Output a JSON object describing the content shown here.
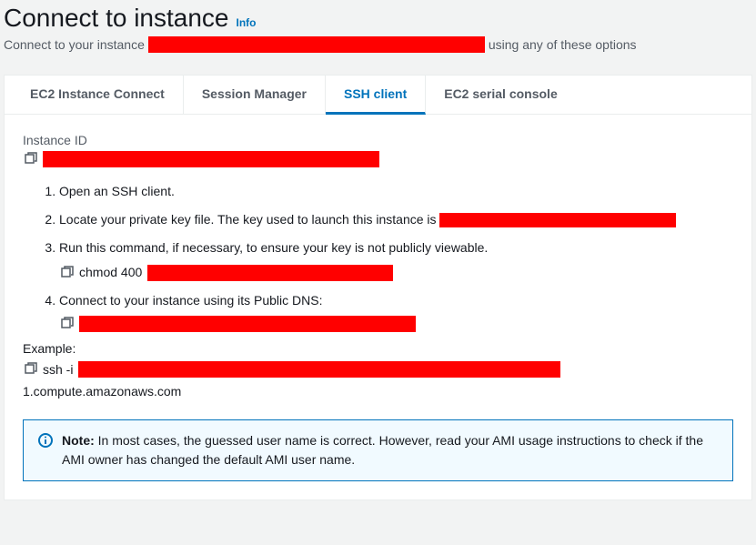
{
  "header": {
    "title": "Connect to instance",
    "info": "Info",
    "subtitle_prefix": "Connect to your instance",
    "subtitle_suffix": "using any of these options"
  },
  "tabs": {
    "ec2_connect": "EC2 Instance Connect",
    "session_manager": "Session Manager",
    "ssh_client": "SSH client",
    "serial_console": "EC2 serial console"
  },
  "content": {
    "instance_id_label": "Instance ID",
    "step1": "Open an SSH client.",
    "step2_prefix": "Locate your private key file. The key used to launch this instance is ",
    "step3": "Run this command, if necessary, to ensure your key is not publicly viewable.",
    "chmod_cmd": "chmod 400",
    "step4": "Connect to your instance using its Public DNS:",
    "example_label": "Example:",
    "ssh_prefix": "ssh -i",
    "ssh_suffix": "1.compute.amazonaws.com"
  },
  "note": {
    "label": "Note:",
    "text": " In most cases, the guessed user name is correct. However, read your AMI usage instructions to check if the AMI owner has changed the default AMI user name."
  }
}
